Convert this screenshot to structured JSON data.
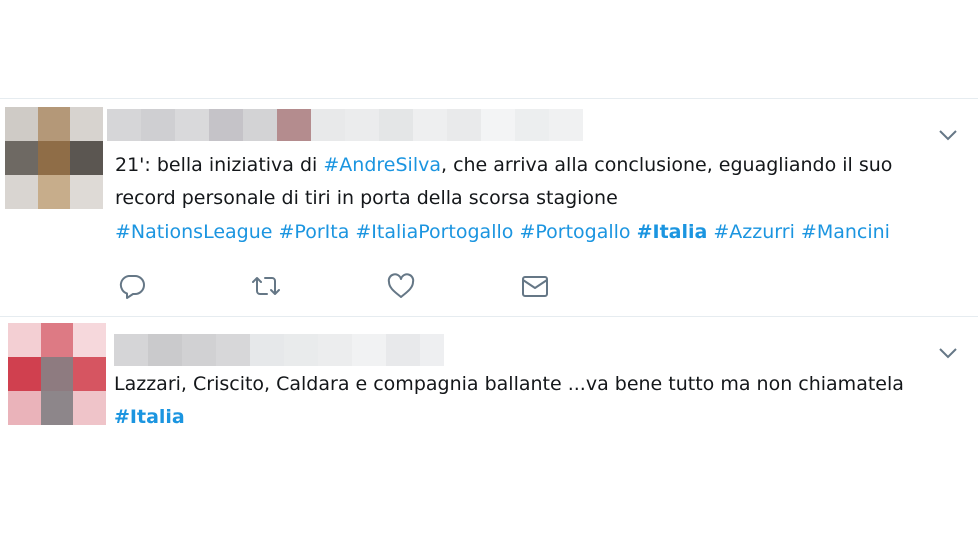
{
  "tweets": [
    {
      "id_label": "tweet-1",
      "text_line1_prefix": "21': bella iniziativa di ",
      "text_line1_tag": "#AndreSilva",
      "text_line1_suffix": ", che arriva alla conclusione, eguagliando il suo",
      "text_line2": "record personale di tiri in porta della scorsa stagione",
      "hashtags": [
        "#NationsLeague",
        "#PorIta",
        "#ItaliaPortogallo",
        "#Portogallo",
        "#Italia",
        "#Azzurri",
        "#Mancini"
      ],
      "bold_hashtag": "#Italia",
      "actions": [
        "reply-icon",
        "retweet-icon",
        "like-icon",
        "direct-message-icon"
      ]
    },
    {
      "id_label": "tweet-2",
      "text_line1": "Lazzari, Criscito, Caldara e compagnia ballante ...va bene tutto ma non chiamatela",
      "text_line2_tag": "#Italia"
    }
  ],
  "colors": {
    "hashtag": "#1b95e0",
    "text": "#14171a",
    "icon": "#657786",
    "separator": "#e6ecf0"
  }
}
